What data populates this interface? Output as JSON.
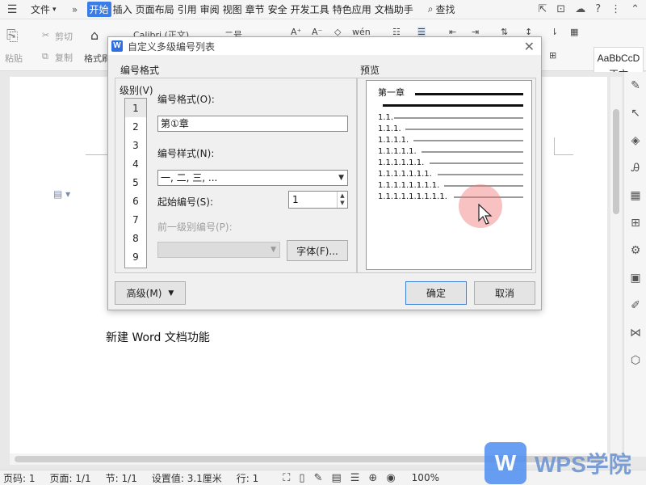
{
  "menubar": {
    "file_label": "文件",
    "tabs": [
      "开始",
      "插入",
      "页面布局",
      "引用",
      "审阅",
      "视图",
      "章节",
      "安全",
      "开发工具",
      "特色应用",
      "文档助手"
    ],
    "active_tab": "开始",
    "search_label": "查找"
  },
  "ribbon": {
    "paste_label": "粘贴",
    "cut_label": "剪切",
    "copy_label": "复制",
    "format_painter_label": "格式刷",
    "font_name": "Calibri (正文)",
    "font_size": "二号",
    "style_preview": "AaBbCcD",
    "style_name": "正文"
  },
  "document": {
    "body_text": "新建 Word 文档功能"
  },
  "dialog": {
    "title": "自定义多级编号列表",
    "section_number_format": "编号格式",
    "level_label": "级别(V)",
    "levels": [
      "1",
      "2",
      "3",
      "4",
      "5",
      "6",
      "7",
      "8",
      "9"
    ],
    "selected_level": "1",
    "number_format_label": "编号格式(O):",
    "number_format_value": "第①章",
    "number_style_label": "编号样式(N):",
    "number_style_value": "一, 二, 三, ...",
    "start_at_label": "起始编号(S):",
    "start_at_value": "1",
    "prev_level_label": "前一级别编号(P):",
    "prev_level_value": "",
    "font_button": "字体(F)...",
    "preview_label": "预览",
    "preview_heading": "第一章",
    "preview_rows": [
      "1.1.",
      "1.1.1.",
      "1.1.1.1.",
      "1.1.1.1.1.",
      "1.1.1.1.1.1.",
      "1.1.1.1.1.1.1.",
      "1.1.1.1.1.1.1.1.",
      "1.1.1.1.1.1.1.1.1."
    ],
    "advanced_button": "高级(M)",
    "ok_button": "确定",
    "cancel_button": "取消"
  },
  "statusbar": {
    "page_number": "页码: 1",
    "pages": "页面: 1/1",
    "section": "节: 1/1",
    "setting": "设置值: 3.1厘米",
    "line": "行: 1",
    "zoom": "100%"
  },
  "watermark": {
    "text": "WPS学院"
  }
}
